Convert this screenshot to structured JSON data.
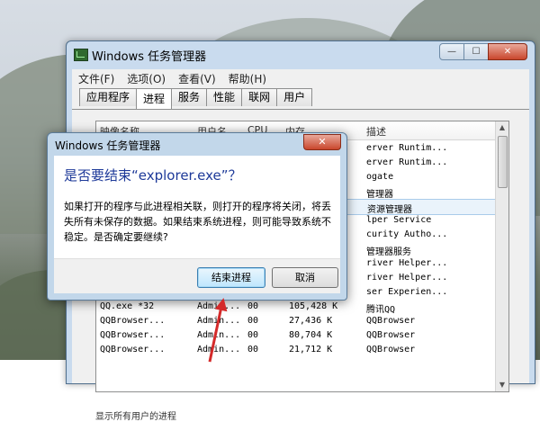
{
  "task_manager": {
    "title": "Windows 任务管理器",
    "menu": [
      "文件(F)",
      "选项(O)",
      "查看(V)",
      "帮助(H)"
    ],
    "tabs": [
      "应用程序",
      "进程",
      "服务",
      "性能",
      "联网",
      "用户"
    ],
    "active_tab": "进程",
    "window_buttons": {
      "minimize": "—",
      "maximize": "☐",
      "close": "✕"
    },
    "process_header": [
      "映像名称",
      "用户名",
      "CPU",
      "内存",
      "描述"
    ],
    "processes": [
      {
        "name": "",
        "user": "",
        "cpu": "",
        "mem": "",
        "desc": "erver Runtim..."
      },
      {
        "name": "",
        "user": "",
        "cpu": "",
        "mem": "",
        "desc": "erver Runtim..."
      },
      {
        "name": "",
        "user": "",
        "cpu": "",
        "mem": "",
        "desc": "ogate"
      },
      {
        "name": "",
        "user": "",
        "cpu": "",
        "mem": "",
        "desc": "管理器"
      },
      {
        "name": "",
        "user": "",
        "cpu": "",
        "mem": "",
        "desc": "资源管理器"
      },
      {
        "name": "",
        "user": "",
        "cpu": "",
        "mem": "",
        "desc": "lper Service"
      },
      {
        "name": "",
        "user": "",
        "cpu": "",
        "mem": "",
        "desc": "curity Autho..."
      },
      {
        "name": "",
        "user": "",
        "cpu": "",
        "mem": "",
        "desc": "管理器服务"
      },
      {
        "name": "",
        "user": "",
        "cpu": "",
        "mem": "",
        "desc": "river Helper..."
      },
      {
        "name": "",
        "user": "",
        "cpu": "",
        "mem": "",
        "desc": "river Helper..."
      },
      {
        "name": "",
        "user": "",
        "cpu": "",
        "mem": "",
        "desc": "ser Experien..."
      },
      {
        "name": "QQ.exe *32",
        "user": "Admin...",
        "cpu": "00",
        "mem": "105,428 K",
        "desc": "腾讯QQ"
      },
      {
        "name": "QQBrowser...",
        "user": "Admin...",
        "cpu": "00",
        "mem": "27,436 K",
        "desc": "QQBrowser"
      },
      {
        "name": "QQBrowser...",
        "user": "Admin...",
        "cpu": "00",
        "mem": "80,704 K",
        "desc": "QQBrowser"
      },
      {
        "name": "QQBrowser...",
        "user": "Admin...",
        "cpu": "00",
        "mem": "21,712 K",
        "desc": "QQBrowser"
      }
    ],
    "selected_index": 4,
    "bottom_text": "显示所有用户的进程"
  },
  "dialog": {
    "title": "Windows 任务管理器",
    "close": "✕",
    "heading": "是否要结束“explorer.exe”？",
    "message": "如果打开的程序与此进程相关联，则打开的程序将关闭，将丢失所有未保存的数据。如果结束系统进程，则可能导致系统不稳定。是否确定要继续?",
    "confirm_label": "结束进程",
    "cancel_label": "取消"
  },
  "colors": {
    "heading": "#1e3a99",
    "annotation_arrow": "#d42a2a"
  }
}
